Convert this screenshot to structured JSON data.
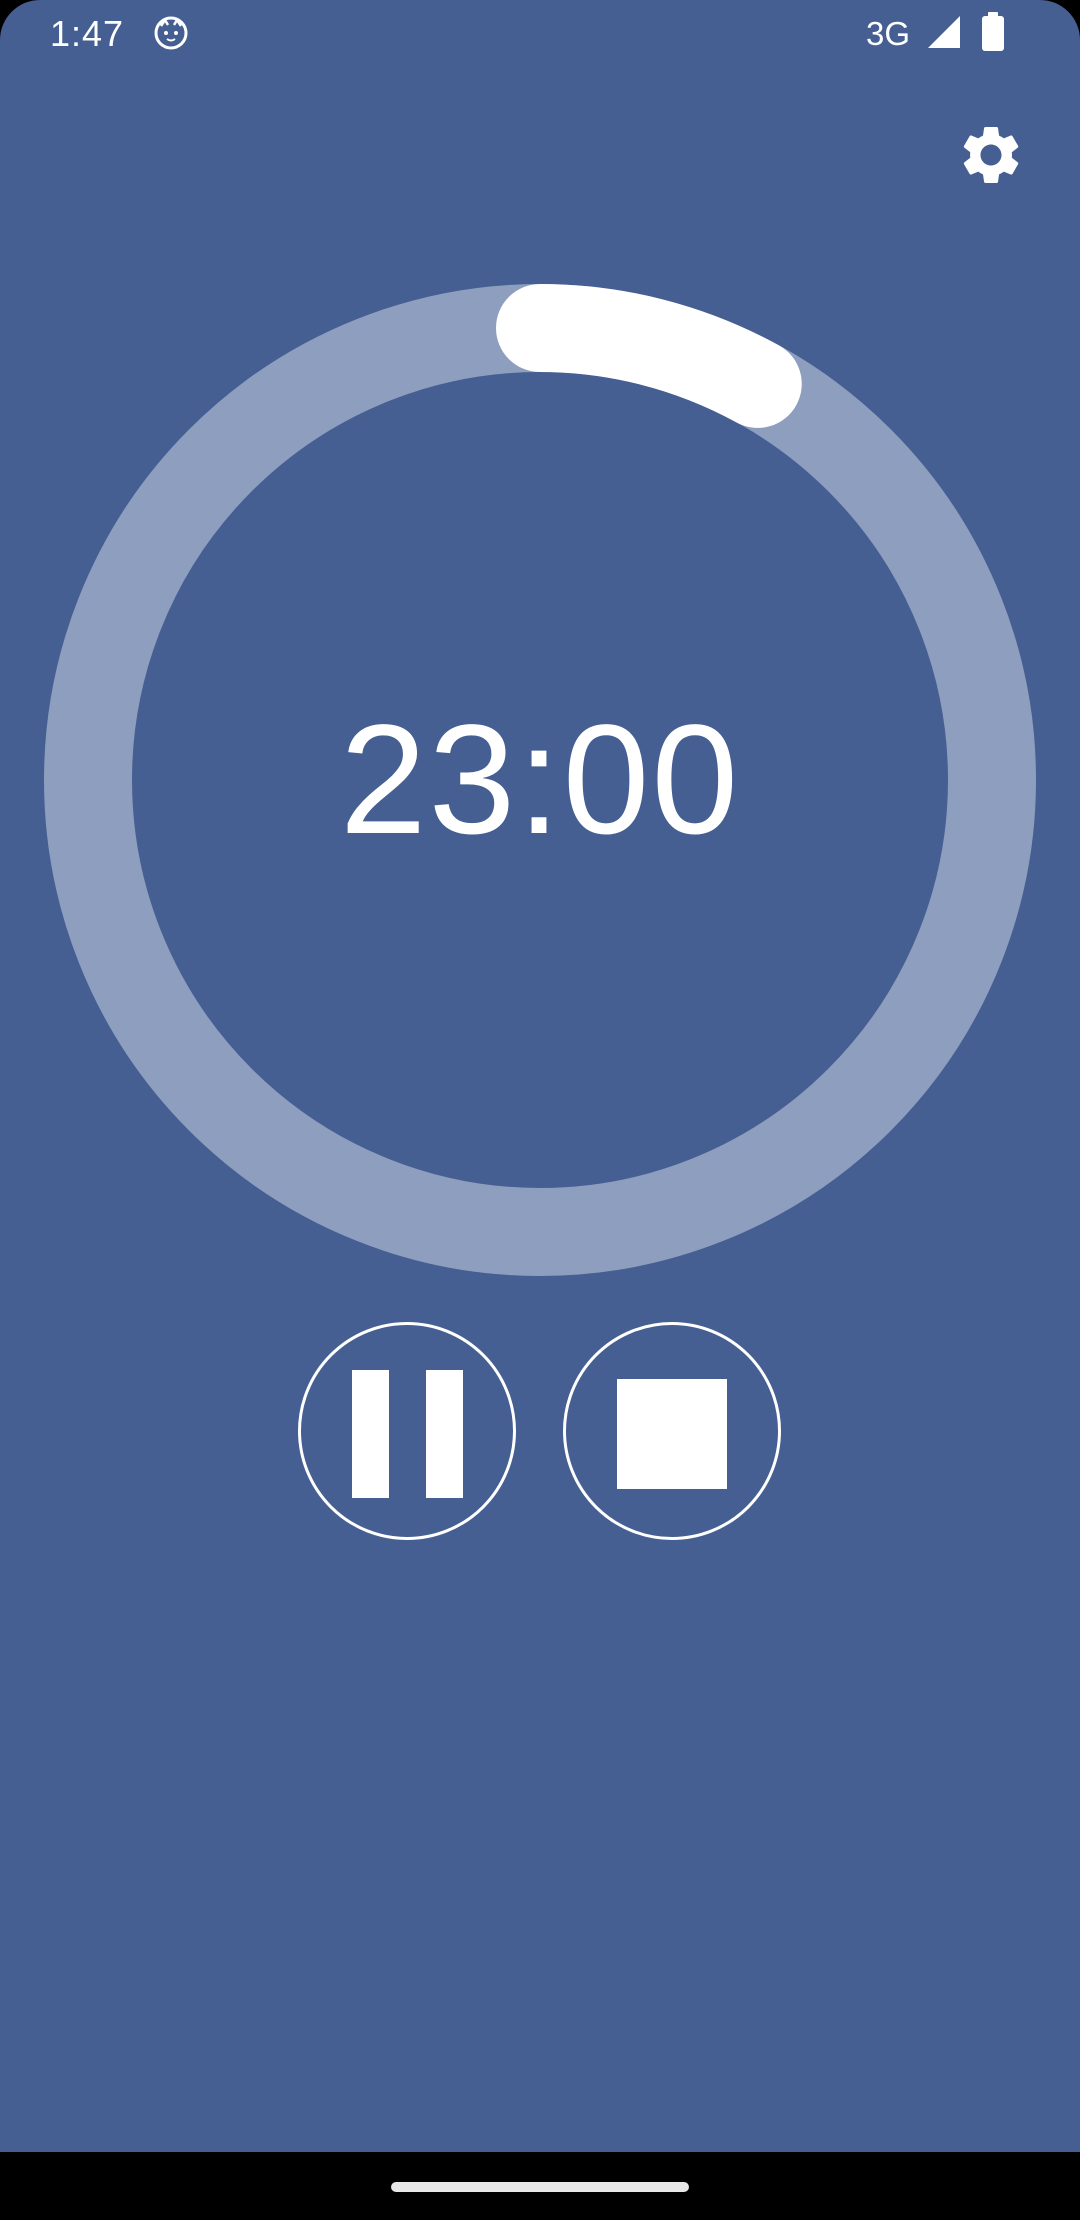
{
  "colors": {
    "background": "#455f92",
    "track": "#8e9ebf",
    "progress": "#ffffff",
    "foreground": "#ffffff",
    "navbar": "#000000"
  },
  "status_bar": {
    "time": "1:47",
    "network": "3G",
    "notification_icon": "cat-face-icon",
    "signal_icon": "cell-signal-icon",
    "battery_icon": "battery-icon"
  },
  "toolbar": {
    "settings_icon": "gear-icon"
  },
  "timer": {
    "display": "23:00",
    "progress_fraction": 0.08
  },
  "controls": {
    "pause_icon": "pause-icon",
    "stop_icon": "stop-icon"
  },
  "nav": {
    "home_handle": "home-gesture-handle"
  }
}
